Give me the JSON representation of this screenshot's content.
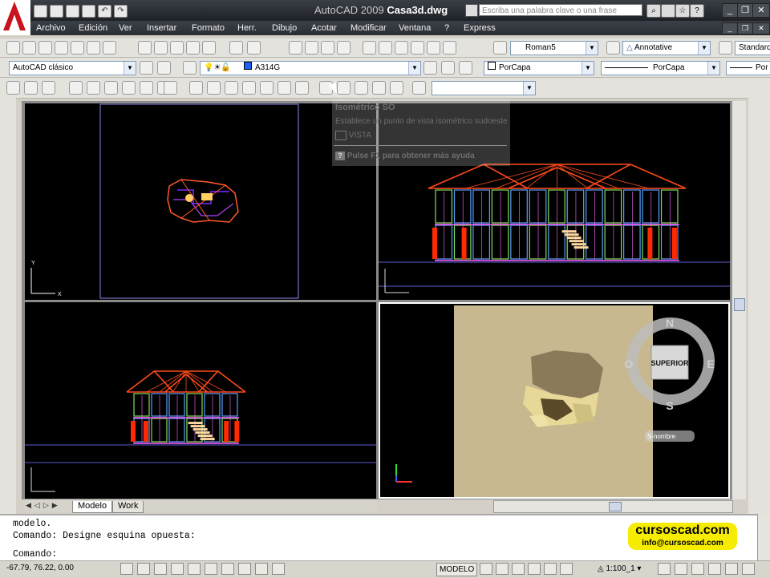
{
  "window": {
    "app": "AutoCAD 2009",
    "file": "Casa3d.dwg",
    "search_placeholder": "Escriba una palabra clave o una frase"
  },
  "menu": [
    "Archivo",
    "Edición",
    "Ver",
    "Insertar",
    "Formato",
    "Herr.",
    "Dibujo",
    "Acotar",
    "Modificar",
    "Ventana",
    "?",
    "Express"
  ],
  "toolbar1": {
    "text_style": "Roman5",
    "annot_style": "Annotative",
    "dim_style": "Standard"
  },
  "toolbar2": {
    "workspace": "AutoCAD clásico",
    "layer": "A314G",
    "color": "PorCapa",
    "linetype": "PorCapa",
    "lineweight": "Por"
  },
  "tooltip": {
    "title": "Isométrico SO",
    "desc": "Establece un punto de vista isométrico sudoeste",
    "command": "VISTA",
    "help": "Pulse F1 para obtener más ayuda"
  },
  "viewcube": {
    "face": "SUPERIOR",
    "north": "N",
    "south": "S",
    "east": "E",
    "west": "O",
    "ucs": "S-nombre"
  },
  "tabs": [
    "Modelo",
    "Work"
  ],
  "command_lines": [
    "modelo.",
    "Comando: Designe esquina opuesta:",
    "Comando:"
  ],
  "brand": {
    "site": "cursoscad.com",
    "email": "info@cursoscad.com"
  },
  "status": {
    "coords": "-67.79, 76.22, 0.00",
    "space": "MODELO",
    "scale": "1:100_1"
  },
  "colors": {
    "roof": "#ff4a1a",
    "frame_blue": "#5aa0ff",
    "frame_green": "#7fe05a",
    "column_red": "#ff2a00",
    "stair": "#ffd8a0",
    "shaded_bg": "#c8b890",
    "ground": "#5a5ad0"
  }
}
